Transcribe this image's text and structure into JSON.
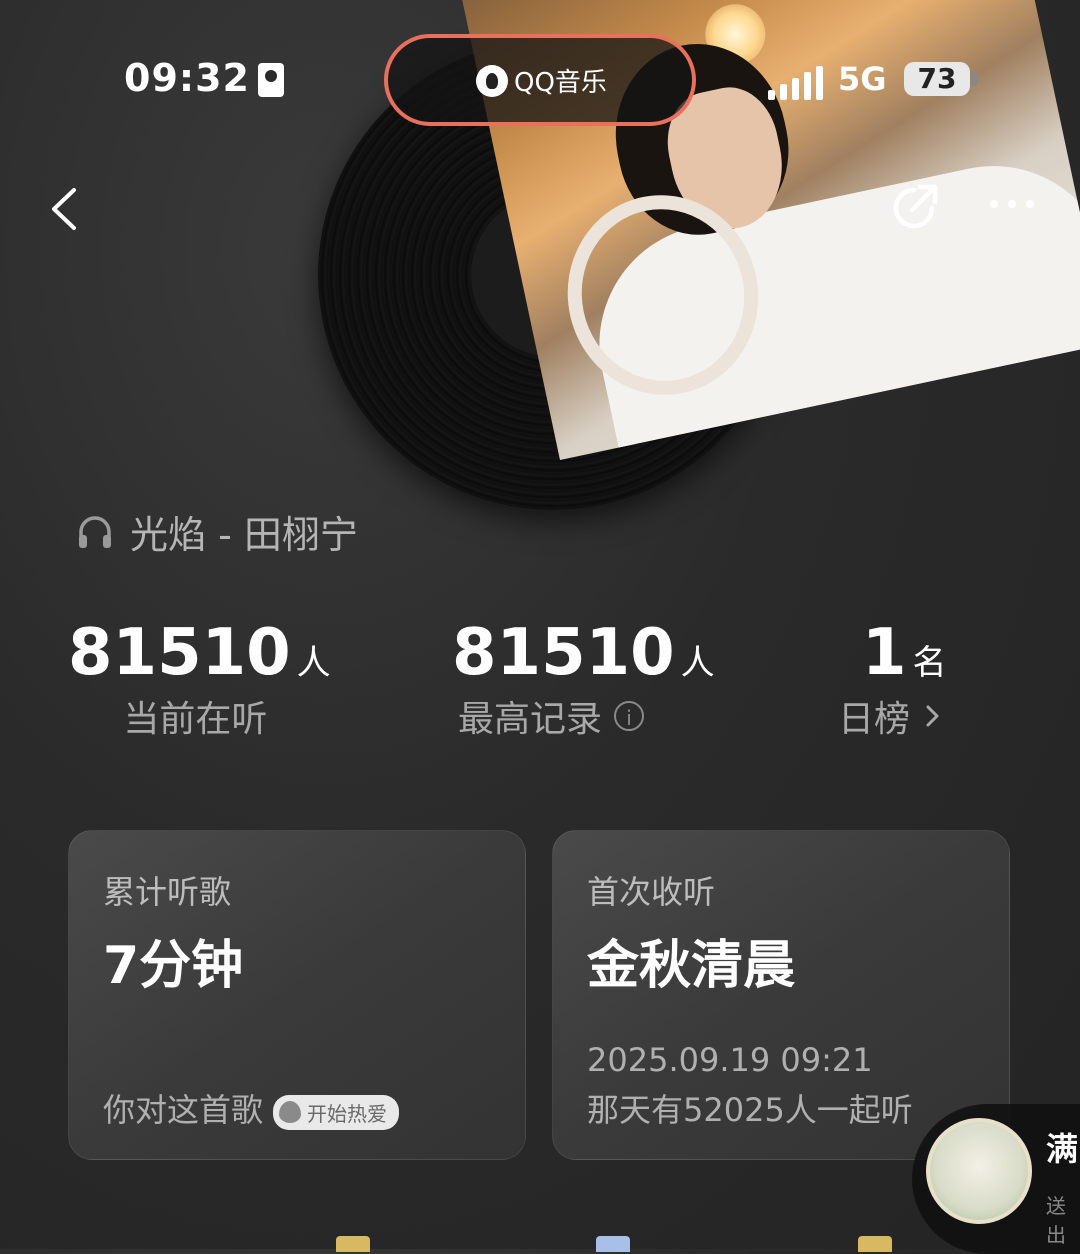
{
  "status_bar": {
    "time": "09:32",
    "app_name": "QQ音乐",
    "network": "5G",
    "battery": "73"
  },
  "song": {
    "title_line": "光焰 - 田栩宁"
  },
  "stats": [
    {
      "value": "81510",
      "unit": "人",
      "label": "当前在听"
    },
    {
      "value": "81510",
      "unit": "人",
      "label": "最高记录"
    },
    {
      "value": "1",
      "unit": "名",
      "label": "日榜"
    }
  ],
  "cards": {
    "total": {
      "label": "累计听歌",
      "value": "7分钟",
      "footer": "你对这首歌",
      "badge": "开始热爱"
    },
    "first": {
      "label": "首次收听",
      "value": "金秋清晨",
      "date": "2025.09.19 09:21",
      "footer": "那天有52025人一起听"
    }
  },
  "floating": {
    "text": "满",
    "subtext": "送出"
  },
  "colors": {
    "pill_border": "#e8705c",
    "background": "#2a2a2a",
    "card": "#3e3e3e"
  }
}
